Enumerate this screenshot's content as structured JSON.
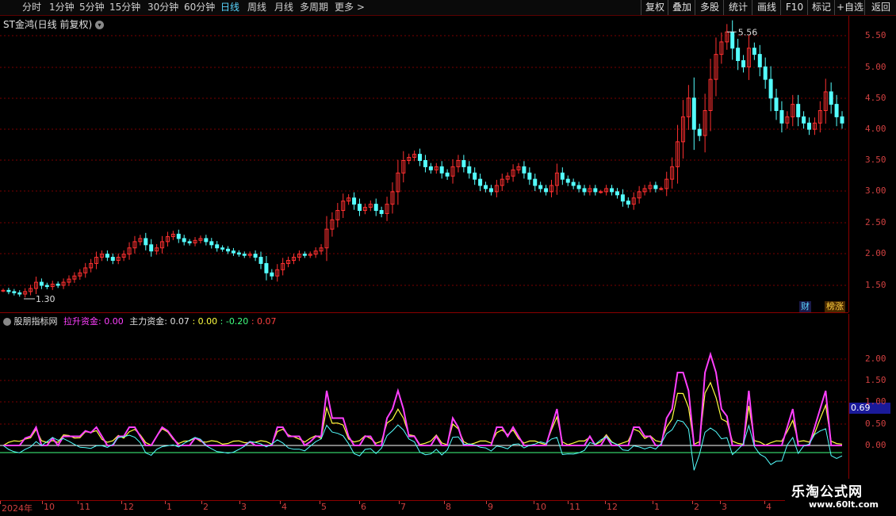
{
  "toolbar": {
    "periods": [
      "分时",
      "1分钟",
      "5分钟",
      "15分钟",
      "30分钟",
      "60分钟",
      "日线",
      "周线",
      "月线",
      "多周期",
      "更多 >"
    ],
    "active_period": "日线",
    "buttons": [
      "复权",
      "叠加",
      "多股",
      "统计",
      "画线",
      "F10",
      "标记",
      "+自选",
      "返回"
    ]
  },
  "main_chart": {
    "title": "ST金鸿(日线 前复权)",
    "high_label": "5.56",
    "low_label": "1.30",
    "y_ticks": [
      "5.50",
      "5.00",
      "4.50",
      "4.00",
      "3.50",
      "3.00",
      "2.50",
      "2.00",
      "1.50"
    ],
    "badges": [
      "财",
      "榜涨"
    ]
  },
  "indicator": {
    "name": "股朋指标网",
    "lift_label": "拉升资金:",
    "lift_value": "0.00",
    "main_label": "主力资金:",
    "main_value": "0.07",
    "v1": ": 0.00",
    "v2": ": -0.20",
    "v3": ": 0.07",
    "y_ticks": [
      "2.00",
      "1.50",
      "1.00",
      "0.50",
      "0.00"
    ],
    "current_value": "0.69"
  },
  "x_axis": [
    "2024年",
    "10",
    "11",
    "12",
    "1",
    "2",
    "3",
    "4",
    "5",
    "6",
    "7",
    "8",
    "9",
    "10",
    "11",
    "12",
    "1",
    "2",
    "3",
    "4"
  ],
  "watermark": {
    "line1": "乐淘公式网",
    "line2": "www.60lt.com"
  },
  "colors": {
    "up": "#ff3030",
    "down": "#54ffff",
    "axis": "#d04040",
    "lift": "#ff40ff",
    "main": "#ffff40",
    "zero": "#ffffff",
    "baseline": "#40ff80"
  },
  "chart_data": {
    "type": "candlestick",
    "ylim": [
      1.3,
      5.6
    ],
    "close": [
      1.42,
      1.4,
      1.38,
      1.36,
      1.4,
      1.45,
      1.55,
      1.5,
      1.48,
      1.52,
      1.5,
      1.55,
      1.6,
      1.65,
      1.7,
      1.78,
      1.85,
      1.95,
      2.0,
      1.95,
      1.9,
      1.95,
      2.0,
      2.1,
      2.2,
      2.25,
      2.15,
      2.05,
      2.1,
      2.2,
      2.28,
      2.32,
      2.25,
      2.2,
      2.18,
      2.22,
      2.25,
      2.2,
      2.15,
      2.1,
      2.08,
      2.05,
      2.02,
      2.0,
      1.98,
      2.0,
      1.95,
      1.85,
      1.7,
      1.65,
      1.75,
      1.85,
      1.9,
      1.95,
      2.0,
      1.98,
      2.0,
      2.05,
      2.1,
      2.4,
      2.55,
      2.7,
      2.85,
      2.9,
      2.8,
      2.7,
      2.75,
      2.8,
      2.7,
      2.65,
      2.8,
      3.0,
      3.3,
      3.5,
      3.55,
      3.6,
      3.5,
      3.4,
      3.35,
      3.4,
      3.3,
      3.25,
      3.4,
      3.5,
      3.4,
      3.3,
      3.2,
      3.1,
      3.05,
      3.0,
      3.1,
      3.2,
      3.25,
      3.35,
      3.4,
      3.3,
      3.2,
      3.1,
      3.05,
      3.0,
      3.1,
      3.3,
      3.2,
      3.15,
      3.1,
      3.05,
      3.0,
      3.05,
      3.0,
      3.0,
      3.05,
      3.0,
      2.95,
      2.85,
      2.8,
      2.9,
      3.0,
      3.05,
      3.1,
      3.05,
      3.05,
      3.2,
      3.4,
      3.8,
      4.2,
      4.5,
      4.0,
      3.9,
      4.3,
      4.8,
      5.2,
      5.4,
      5.56,
      5.3,
      5.1,
      5.0,
      5.3,
      5.2,
      5.0,
      4.8,
      4.5,
      4.3,
      4.1,
      4.2,
      4.4,
      4.2,
      4.1,
      4.0,
      4.1,
      4.3,
      4.6,
      4.4,
      4.2,
      4.1
    ]
  }
}
